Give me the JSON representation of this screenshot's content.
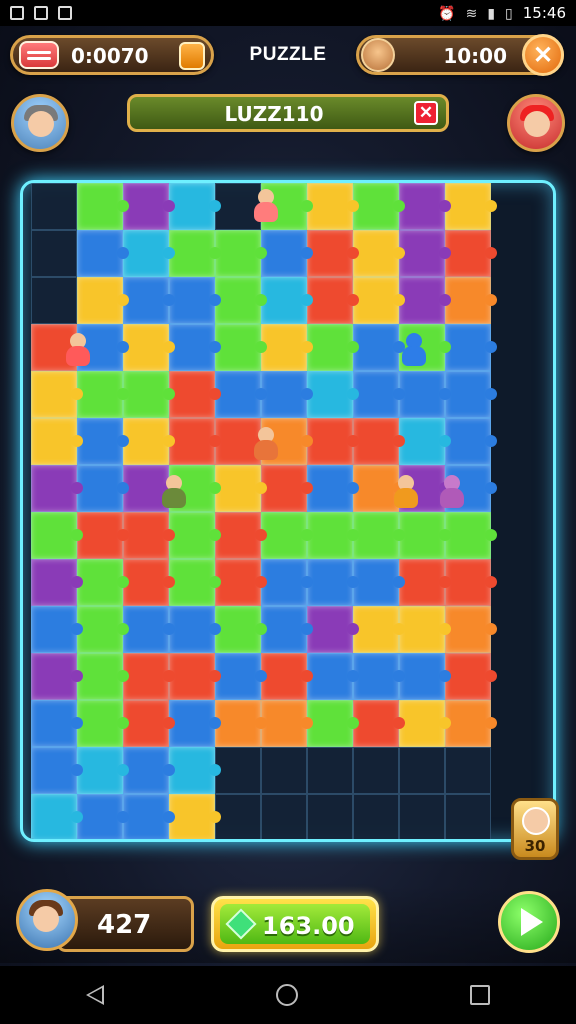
{
  "status_bar": {
    "time": "15:46"
  },
  "hud": {
    "timer": "0:0070",
    "title": "PUZZLE",
    "goal_time": "10:00",
    "close_glyph": "✕"
  },
  "word_bar": {
    "text": "LUZZ110",
    "clear_glyph": "✕"
  },
  "board": {
    "rows": [
      [
        "e",
        "g",
        "p",
        "c",
        "e",
        "g",
        "y",
        "g",
        "p",
        "y"
      ],
      [
        "e",
        "b",
        "c",
        "g",
        "g",
        "b",
        "r",
        "y",
        "p",
        "r"
      ],
      [
        "e",
        "y",
        "b",
        "b",
        "g",
        "c",
        "r",
        "y",
        "p",
        "o"
      ],
      [
        "r",
        "b",
        "y",
        "b",
        "g",
        "y",
        "g",
        "b",
        "g",
        "b"
      ],
      [
        "y",
        "g",
        "g",
        "r",
        "b",
        "b",
        "c",
        "b",
        "b",
        "b"
      ],
      [
        "y",
        "b",
        "y",
        "r",
        "r",
        "o",
        "r",
        "r",
        "c",
        "b"
      ],
      [
        "p",
        "b",
        "p",
        "g",
        "y",
        "r",
        "b",
        "o",
        "p",
        "b"
      ],
      [
        "g",
        "r",
        "r",
        "g",
        "r",
        "g",
        "g",
        "g",
        "g",
        "g"
      ],
      [
        "p",
        "g",
        "r",
        "g",
        "r",
        "b",
        "b",
        "b",
        "r",
        "r"
      ],
      [
        "b",
        "g",
        "b",
        "b",
        "g",
        "b",
        "p",
        "y",
        "y",
        "o"
      ],
      [
        "p",
        "g",
        "r",
        "r",
        "b",
        "r",
        "b",
        "b",
        "b",
        "r"
      ],
      [
        "b",
        "g",
        "r",
        "b",
        "o",
        "o",
        "g",
        "r",
        "y",
        "o"
      ],
      [
        "b",
        "c",
        "b",
        "c",
        "e",
        "e",
        "e",
        "e",
        "e",
        "e"
      ],
      [
        "c",
        "b",
        "b",
        "y",
        "e",
        "e",
        "e",
        "e",
        "e",
        "e"
      ]
    ]
  },
  "side_badge": {
    "value": "30"
  },
  "bottom": {
    "score": "427",
    "coins": "163.00"
  },
  "icons": {
    "timer": "timer-icon",
    "pause": "pause-icon",
    "close": "close-icon",
    "play": "play-icon",
    "gem": "gem-icon"
  },
  "colors": {
    "board_glow": "#6ff0ff",
    "gold_border": "#d9a24a",
    "green": "#5fe13a",
    "blue": "#2c7de0",
    "yellow": "#f8c52a",
    "red": "#ee4a2f",
    "orange": "#f7892a",
    "purple": "#8a3bb7"
  }
}
